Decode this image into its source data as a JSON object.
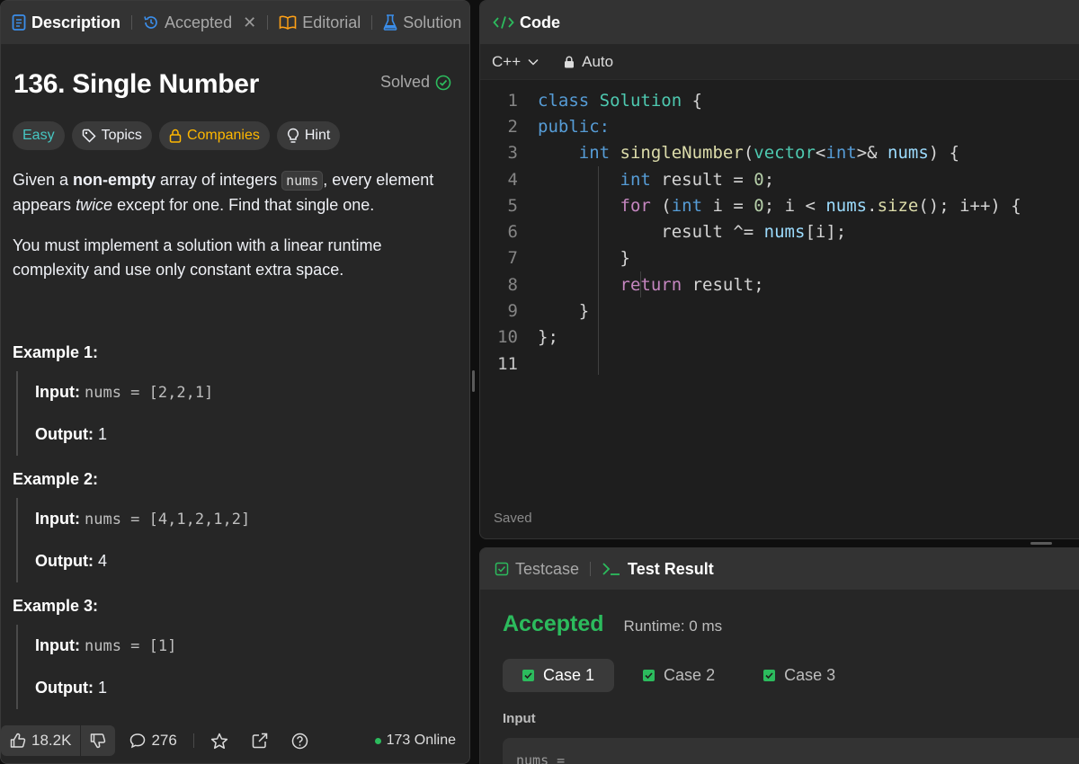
{
  "left_tabs": [
    {
      "label": "Description"
    },
    {
      "label": "Accepted"
    },
    {
      "label": "Editorial"
    },
    {
      "label": "Solution"
    }
  ],
  "problem": {
    "title": "136. Single Number",
    "status": "Solved",
    "chips": {
      "difficulty": "Easy",
      "topics": "Topics",
      "companies": "Companies",
      "hint": "Hint"
    },
    "p1": {
      "a": "Given a ",
      "b": "non-empty",
      "c": " array of integers ",
      "code": "nums",
      "d": ", every element appears ",
      "e": "twice",
      "f": " except for one. Find that single one."
    },
    "p2": "You must implement a solution with a linear runtime complexity and use only constant extra space.",
    "examples": [
      {
        "heading": "Example 1:",
        "input_label": "Input:",
        "input": "nums = [2,2,1]",
        "output_label": "Output:",
        "output": "1"
      },
      {
        "heading": "Example 2:",
        "input_label": "Input:",
        "input": "nums = [4,1,2,1,2]",
        "output_label": "Output:",
        "output": "4"
      },
      {
        "heading": "Example 3:",
        "input_label": "Input:",
        "input": "nums = [1]",
        "output_label": "Output:",
        "output": "1"
      }
    ]
  },
  "footer": {
    "likes": "18.2K",
    "comments": "276",
    "online": "173 Online"
  },
  "code": {
    "header": "Code",
    "language": "C++",
    "mode": "Auto",
    "saved": "Saved",
    "line_numbers": [
      "1",
      "2",
      "3",
      "4",
      "5",
      "6",
      "7",
      "8",
      "9",
      "10",
      "11"
    ]
  },
  "result": {
    "tabs": {
      "testcase": "Testcase",
      "test_result": "Test Result"
    },
    "status": "Accepted",
    "runtime": "Runtime: 0 ms",
    "cases": [
      "Case 1",
      "Case 2",
      "Case 3"
    ],
    "input_label": "Input",
    "input_value": "nums ="
  },
  "colors": {
    "accent_green": "#2cbb5d",
    "easy": "#46c6c2",
    "companies": "#ffb800",
    "panel": "#262626",
    "editor": "#1e1e1e"
  }
}
